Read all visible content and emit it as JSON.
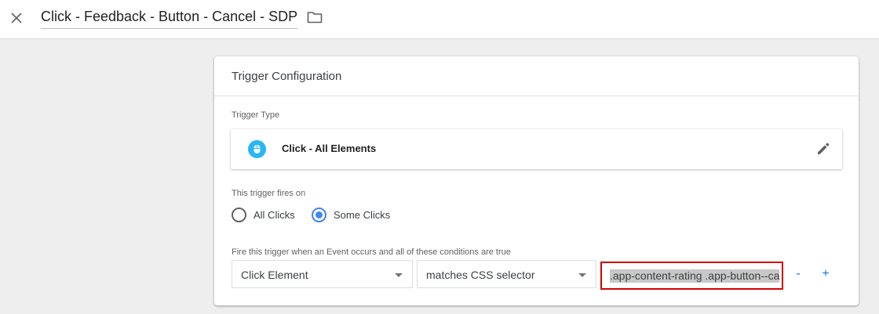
{
  "header": {
    "title": "Click - Feedback - Button - Cancel - SDP",
    "close_icon": "close-icon",
    "folder_icon": "folder-icon"
  },
  "card": {
    "title": "Trigger Configuration",
    "trigger_type": {
      "label": "Trigger Type",
      "name": "Click - All Elements",
      "icon": "mouse-icon",
      "icon_color": "#29b6f6"
    },
    "fires_on": {
      "label": "This trigger fires on",
      "options": [
        {
          "label": "All Clicks",
          "selected": false
        },
        {
          "label": "Some Clicks",
          "selected": true
        }
      ]
    },
    "conditions": {
      "label": "Fire this trigger when an Event occurs and all of these conditions are true",
      "variable": "Click Element",
      "operator": "matches CSS selector",
      "value": ".app-content-rating  .app-button--ca",
      "remove_label": "-",
      "add_label": "+"
    }
  },
  "colors": {
    "accent": "#4285f4",
    "highlight_border": "#d50000",
    "link_blue": "#1a73e8"
  }
}
